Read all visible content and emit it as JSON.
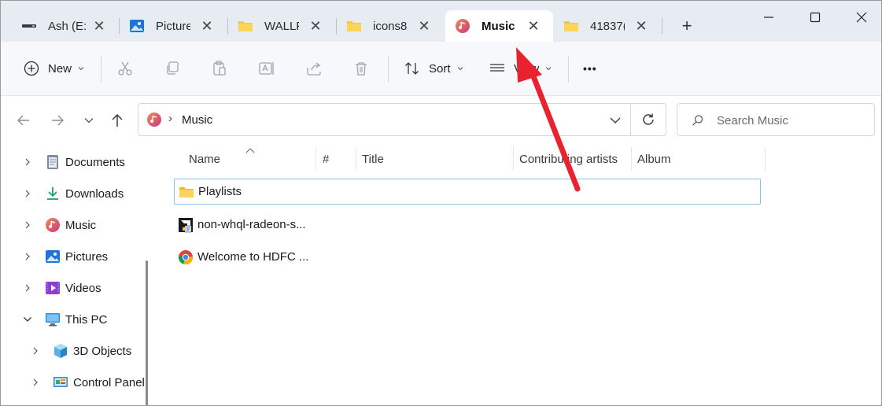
{
  "tabs": [
    {
      "label": "Ash (E:",
      "icon": "drive-icon"
    },
    {
      "label": "Picture",
      "icon": "pictures-icon"
    },
    {
      "label": "WALLF",
      "icon": "folder-icon"
    },
    {
      "label": "icons8",
      "icon": "folder-icon"
    },
    {
      "label": "Music",
      "icon": "music-icon",
      "active": true
    },
    {
      "label": "41837(",
      "icon": "folder-icon"
    }
  ],
  "toolbar": {
    "new_label": "New",
    "sort_label": "Sort",
    "view_label": "View",
    "more_label": "•••"
  },
  "address": {
    "path": [
      "Music"
    ],
    "separator": "›"
  },
  "search": {
    "placeholder": "Search Music"
  },
  "sidebar": {
    "items": [
      {
        "label": "Documents",
        "icon": "documents-icon"
      },
      {
        "label": "Downloads",
        "icon": "downloads-icon"
      },
      {
        "label": "Music",
        "icon": "music-icon"
      },
      {
        "label": "Pictures",
        "icon": "pictures-icon"
      },
      {
        "label": "Videos",
        "icon": "videos-icon"
      },
      {
        "label": "This PC",
        "icon": "this-pc-icon",
        "expanded": true
      },
      {
        "label": "3D Objects",
        "icon": "3d-objects-icon"
      },
      {
        "label": "Control Panel",
        "icon": "control-panel-icon"
      }
    ]
  },
  "columns": {
    "name": "Name",
    "number": "#",
    "title": "Title",
    "artists": "Contributing artists",
    "album": "Album"
  },
  "files": [
    {
      "name": "Playlists",
      "icon": "folder-icon",
      "selected": true
    },
    {
      "name": "non-whql-radeon-s...",
      "icon": "amd-installer-icon"
    },
    {
      "name": "Welcome to HDFC ...",
      "icon": "chrome-icon"
    }
  ],
  "colors": {
    "tabbar_bg": "#e7ecf3",
    "toolbar_bg": "#f6f8fb",
    "selection_border": "#8fc3e6",
    "annotation_arrow": "#e8232f",
    "folder_yellow": "#f8c63d"
  }
}
